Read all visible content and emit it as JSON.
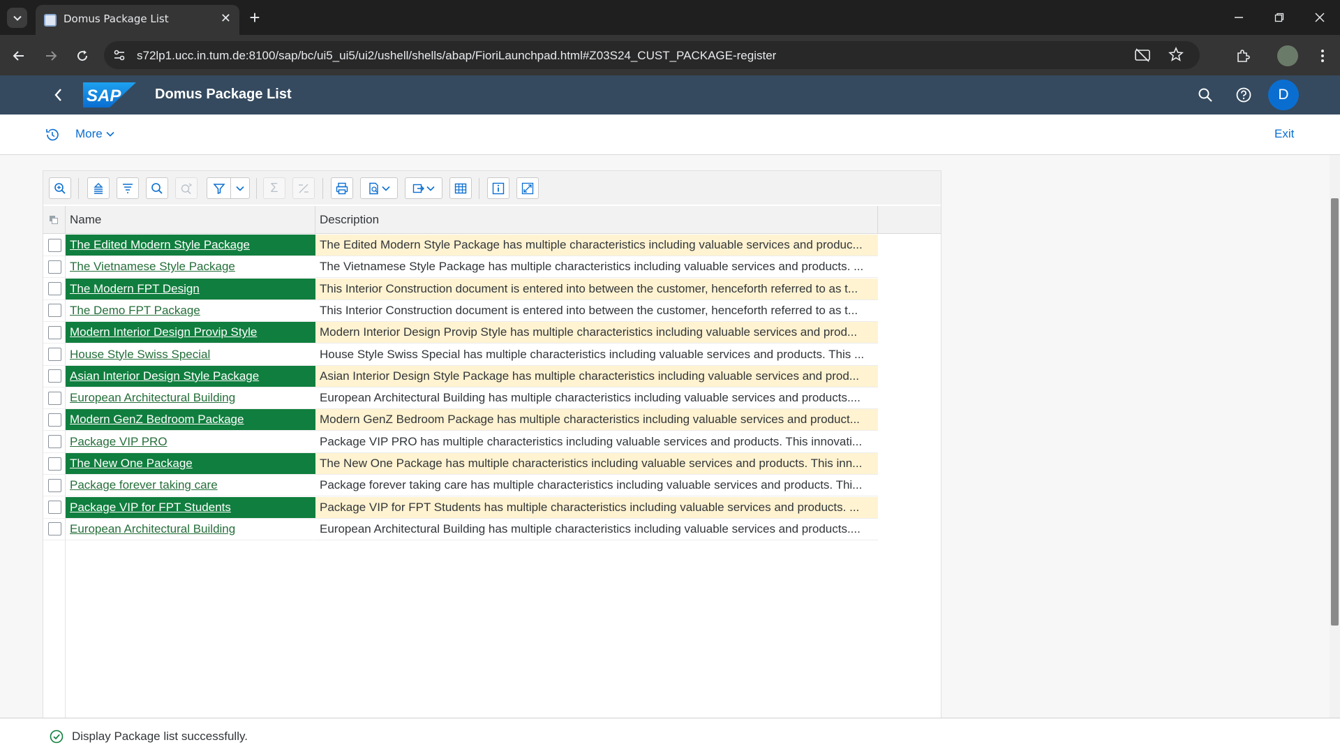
{
  "browser": {
    "tab_title": "Domus Package List",
    "tab_close": "✕",
    "new_tab": "+",
    "url": "s72lp1.ucc.in.tum.de:8100/sap/bc/ui5_ui5/ui2/ushell/shells/abap/FioriLaunchpad.html#Z03S24_CUST_PACKAGE-register"
  },
  "shell": {
    "logo_text": "SAP",
    "title": "Domus Package List",
    "avatar_initial": "D"
  },
  "subbar": {
    "more_label": "More",
    "exit_label": "Exit"
  },
  "alv": {
    "columns": {
      "name": "Name",
      "description": "Description"
    },
    "sigma": "Σ",
    "rows": [
      {
        "name": "The Edited Modern Style Package",
        "description": "The Edited Modern Style Package has multiple characteristics including valuable services and produc...",
        "highlight": true
      },
      {
        "name": "The Vietnamese Style Package",
        "description": "The Vietnamese Style Package has multiple characteristics including valuable services and products. ...",
        "highlight": false
      },
      {
        "name": "The Modern FPT Design",
        "description": "This Interior Construction document is entered into between the customer, henceforth referred to as t...",
        "highlight": true
      },
      {
        "name": "The Demo FPT Package",
        "description": "This Interior Construction document is entered into between the customer, henceforth referred to as t...",
        "highlight": false
      },
      {
        "name": "Modern Interior Design Provip Style",
        "description": "Modern Interior Design Provip Style has multiple characteristics including valuable services and prod...",
        "highlight": true
      },
      {
        "name": "House Style Swiss Special",
        "description": "House Style Swiss Special has multiple characteristics including valuable services and products. This ...",
        "highlight": false
      },
      {
        "name": "Asian Interior Design Style Package",
        "description": "Asian Interior Design Style Package has multiple characteristics including valuable services and prod...",
        "highlight": true
      },
      {
        "name": "European Architectural Building",
        "description": "European Architectural Building has multiple characteristics including valuable services and products....",
        "highlight": false
      },
      {
        "name": "Modern GenZ Bedroom Package",
        "description": "Modern GenZ Bedroom Package has multiple characteristics including valuable services and product...",
        "highlight": true
      },
      {
        "name": "Package VIP PRO",
        "description": "Package VIP PRO has multiple characteristics including valuable services and products. This innovati...",
        "highlight": false
      },
      {
        "name": "The New One Package",
        "description": "The New One Package has multiple characteristics including valuable services and products. This inn...",
        "highlight": true
      },
      {
        "name": "Package forever taking care",
        "description": "Package forever taking care has multiple characteristics including valuable services and products. Thi...",
        "highlight": false
      },
      {
        "name": "Package VIP for FPT Students",
        "description": "Package VIP for FPT Students has multiple characteristics including valuable services and products. ...",
        "highlight": true
      },
      {
        "name": "European Architectural Building",
        "description": "European Architectural Building has multiple characteristics including valuable services and products....",
        "highlight": false
      }
    ]
  },
  "status": {
    "message": "Display Package list successfully."
  },
  "colors": {
    "shell_bg": "#354a5f",
    "highlight_green": "#107e3e",
    "highlight_desc_bg": "#fff3d1",
    "link_green": "#256f3a",
    "accent_blue": "#0a6ed1"
  }
}
